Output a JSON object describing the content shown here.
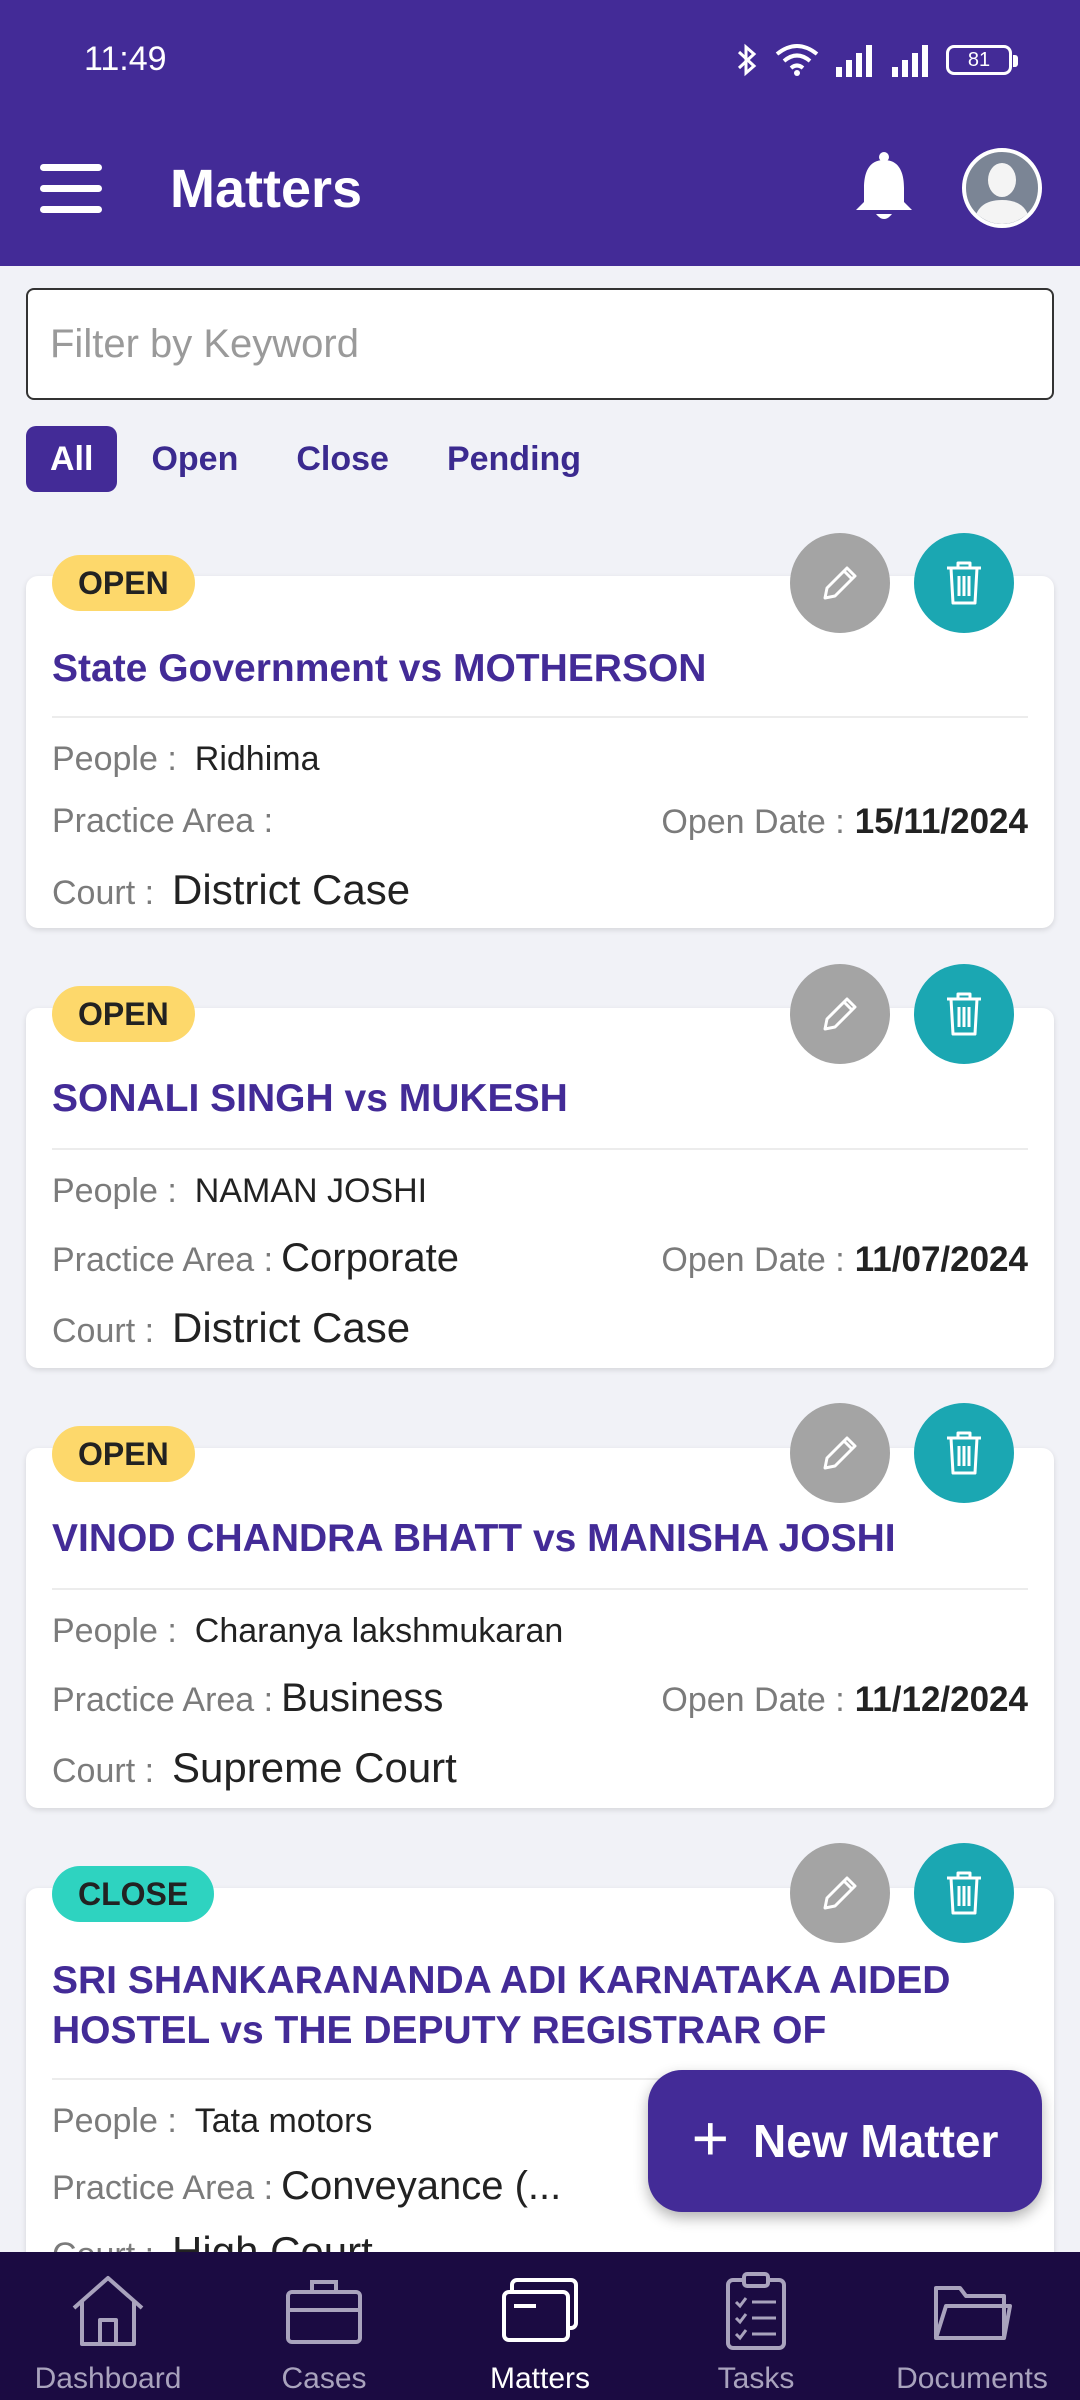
{
  "status_bar": {
    "time": "11:49",
    "battery": "81"
  },
  "app_bar": {
    "title": "Matters"
  },
  "search": {
    "placeholder": "Filter by Keyword",
    "value": ""
  },
  "filters": [
    {
      "label": "All",
      "active": true
    },
    {
      "label": "Open",
      "active": false
    },
    {
      "label": "Close",
      "active": false
    },
    {
      "label": "Pending",
      "active": false
    }
  ],
  "labels": {
    "people": "People :",
    "practice_area": "Practice Area :",
    "open_date": "Open Date :",
    "court": "Court :"
  },
  "matters": [
    {
      "status": "OPEN",
      "title": "State Government vs MOTHERSON",
      "people": "Ridhima",
      "practice_area": "",
      "open_date": "15/11/2024",
      "court": "District Case"
    },
    {
      "status": "OPEN",
      "title": "SONALI SINGH vs MUKESH",
      "people": "NAMAN JOSHI",
      "practice_area": "Corporate",
      "open_date": "11/07/2024",
      "court": "District Case"
    },
    {
      "status": "OPEN",
      "title": "VINOD CHANDRA BHATT vs MANISHA JOSHI",
      "people": "Charanya lakshmukaran",
      "practice_area": "Business",
      "open_date": "11/12/2024",
      "court": "Supreme Court"
    },
    {
      "status": "CLOSE",
      "title": "SRI SHANKARANANDA ADI KARNATAKA AIDED HOSTEL vs THE DEPUTY REGISTRAR OF",
      "people": "Tata motors",
      "practice_area": "Conveyance (...",
      "open_date": "",
      "court": "High Court"
    }
  ],
  "fab": {
    "plus": "+",
    "label": "New Matter"
  },
  "bottom_nav": [
    {
      "label": "Dashboard",
      "icon": "home-icon",
      "active": false
    },
    {
      "label": "Cases",
      "icon": "briefcase-icon",
      "active": false
    },
    {
      "label": "Matters",
      "icon": "card-icon",
      "active": true
    },
    {
      "label": "Tasks",
      "icon": "clipboard-icon",
      "active": false
    },
    {
      "label": "Documents",
      "icon": "folder-icon",
      "active": false
    }
  ],
  "colors": {
    "primary": "#432b97",
    "open_badge": "#fdd86b",
    "close_badge": "#2ed3c0",
    "edit_button": "#a4a4a4",
    "delete_button": "#1ba7b2",
    "nav_bg": "#1b0b42"
  }
}
